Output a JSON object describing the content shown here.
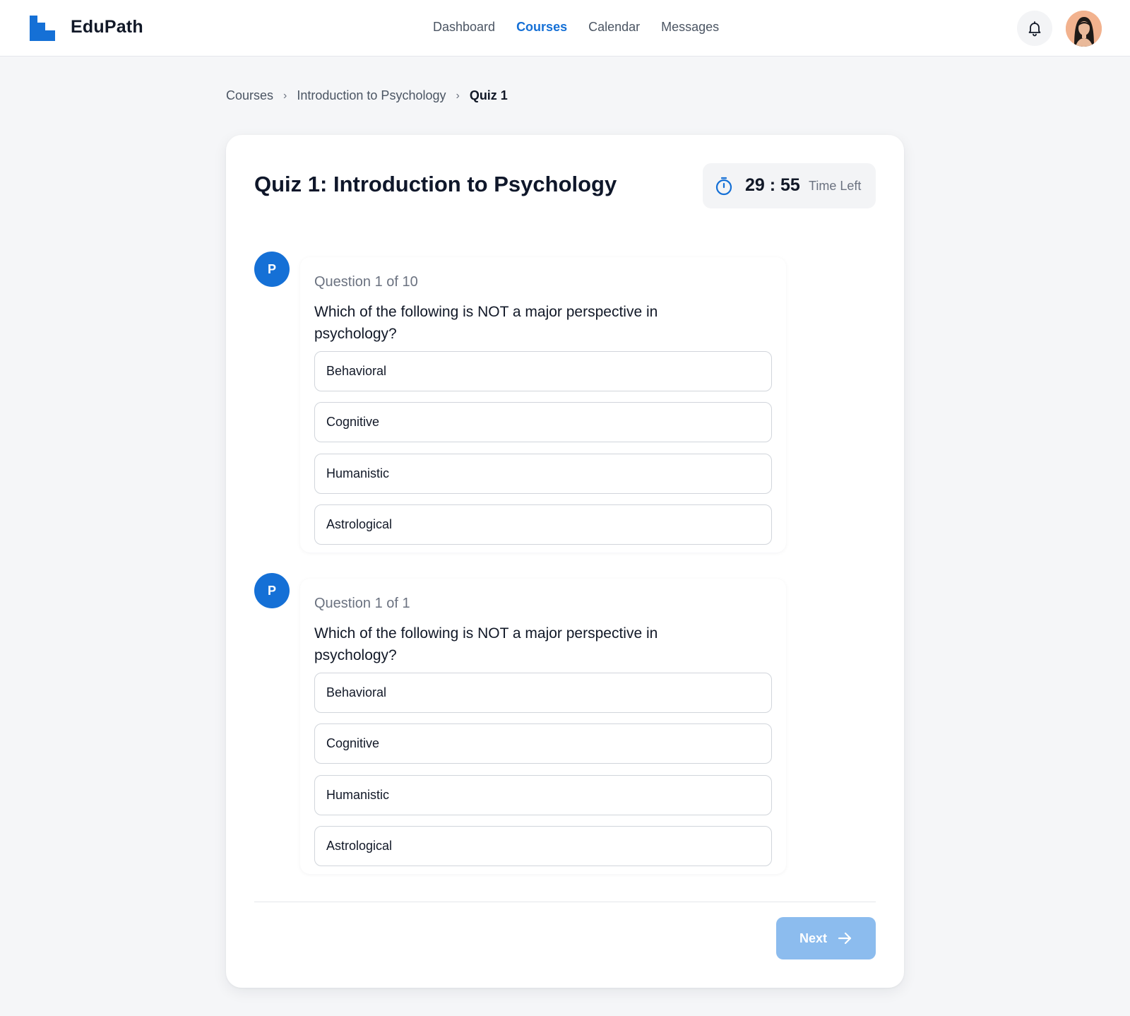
{
  "app": {
    "brand": "EduPath"
  },
  "nav": {
    "items": [
      {
        "label": "Dashboard",
        "active": false
      },
      {
        "label": "Courses",
        "active": true
      },
      {
        "label": "Calendar",
        "active": false
      },
      {
        "label": "Messages",
        "active": false
      }
    ]
  },
  "header": {
    "notification_icon": "bell-icon",
    "avatar": "user-avatar"
  },
  "breadcrumb": {
    "items": [
      "Courses",
      "Introduction to Psychology",
      "Quiz 1"
    ],
    "separator": "›"
  },
  "quiz": {
    "title": "Quiz 1: Introduction to Psychology",
    "timer": {
      "minutes": "29",
      "seconds": "55",
      "display": "29 : 55",
      "label": "Time Left"
    }
  },
  "questions": [
    {
      "avatar_letter": "P",
      "count_label": "Question 1 of 10",
      "text": "Which of the following is NOT a major perspective in psychology?",
      "options": [
        "Behavioral",
        "Cognitive",
        "Humanistic",
        "Astrological"
      ]
    },
    {
      "avatar_letter": "P",
      "count_label": "Question 1 of 1",
      "text": "Which of the following is NOT a major perspective in psychology?",
      "options": [
        "Behavioral",
        "Cognitive",
        "Humanistic",
        "Astrological"
      ]
    }
  ],
  "footer": {
    "next_label": "Next",
    "next_icon": "arrow-right-icon"
  },
  "colors": {
    "accent": "#1570d6",
    "next_button_disabled": "#8cbcee",
    "background": "#f5f6f8",
    "card": "#ffffff"
  }
}
